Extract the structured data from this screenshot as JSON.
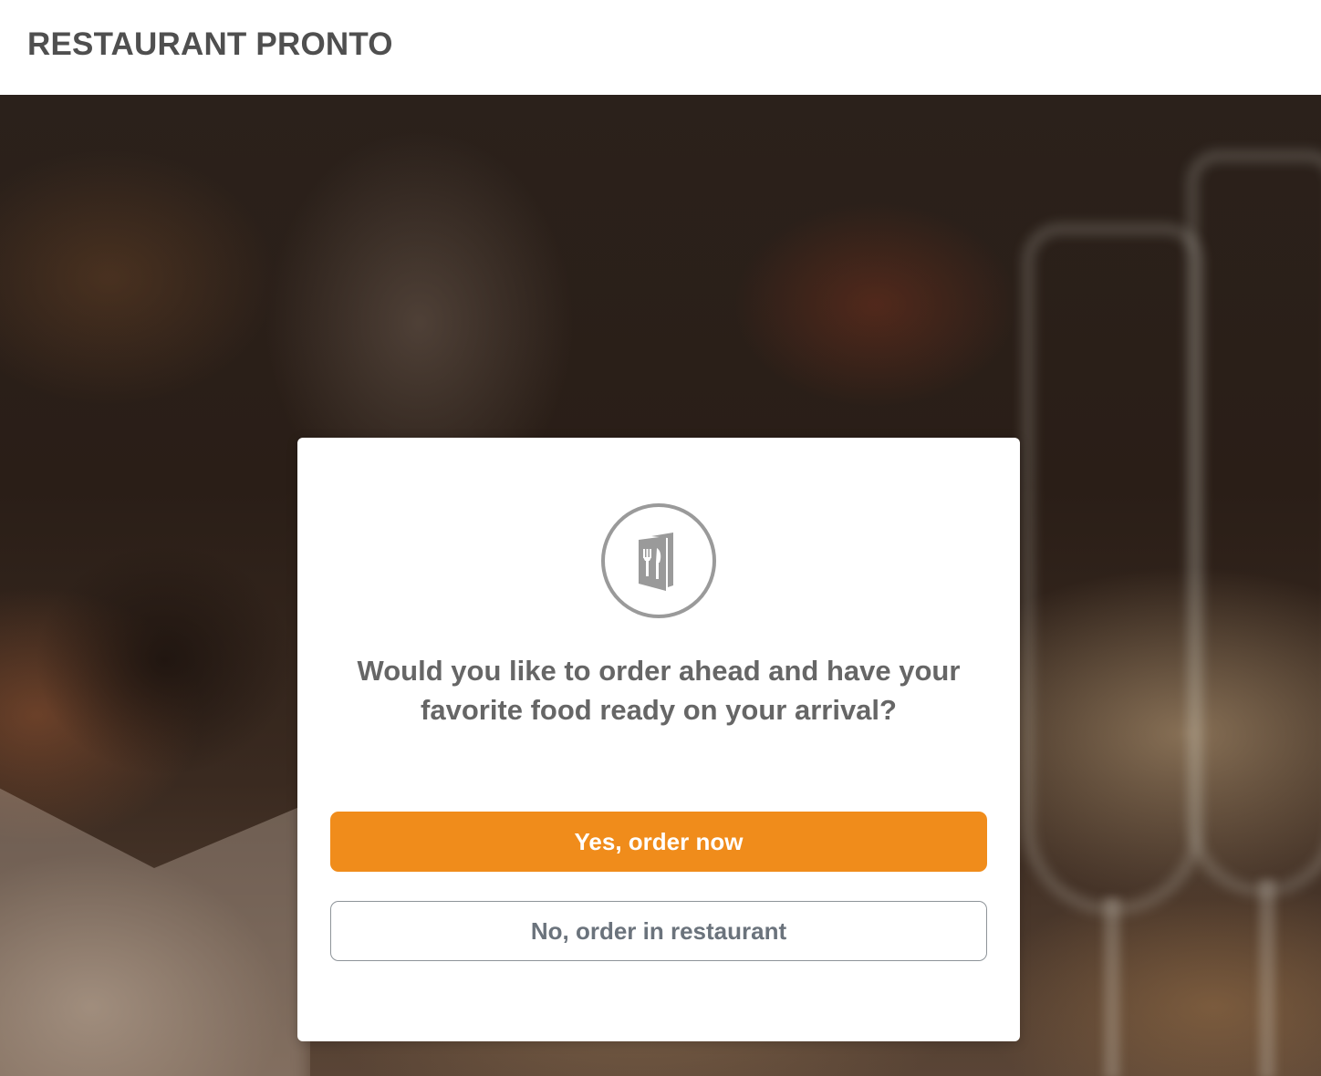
{
  "header": {
    "brand": "RESTAURANT PRONTO"
  },
  "modal": {
    "icon": "menu-fork-knife-icon",
    "question": "Would you like to order ahead and have your favorite food ready on your arrival?",
    "primary_button": "Yes, order now",
    "secondary_button": "No, order in restaurant"
  },
  "colors": {
    "accent": "#f08c1b",
    "title_text": "#4f4f4f",
    "body_text": "#666666",
    "secondary_button_text": "#6b737c"
  }
}
